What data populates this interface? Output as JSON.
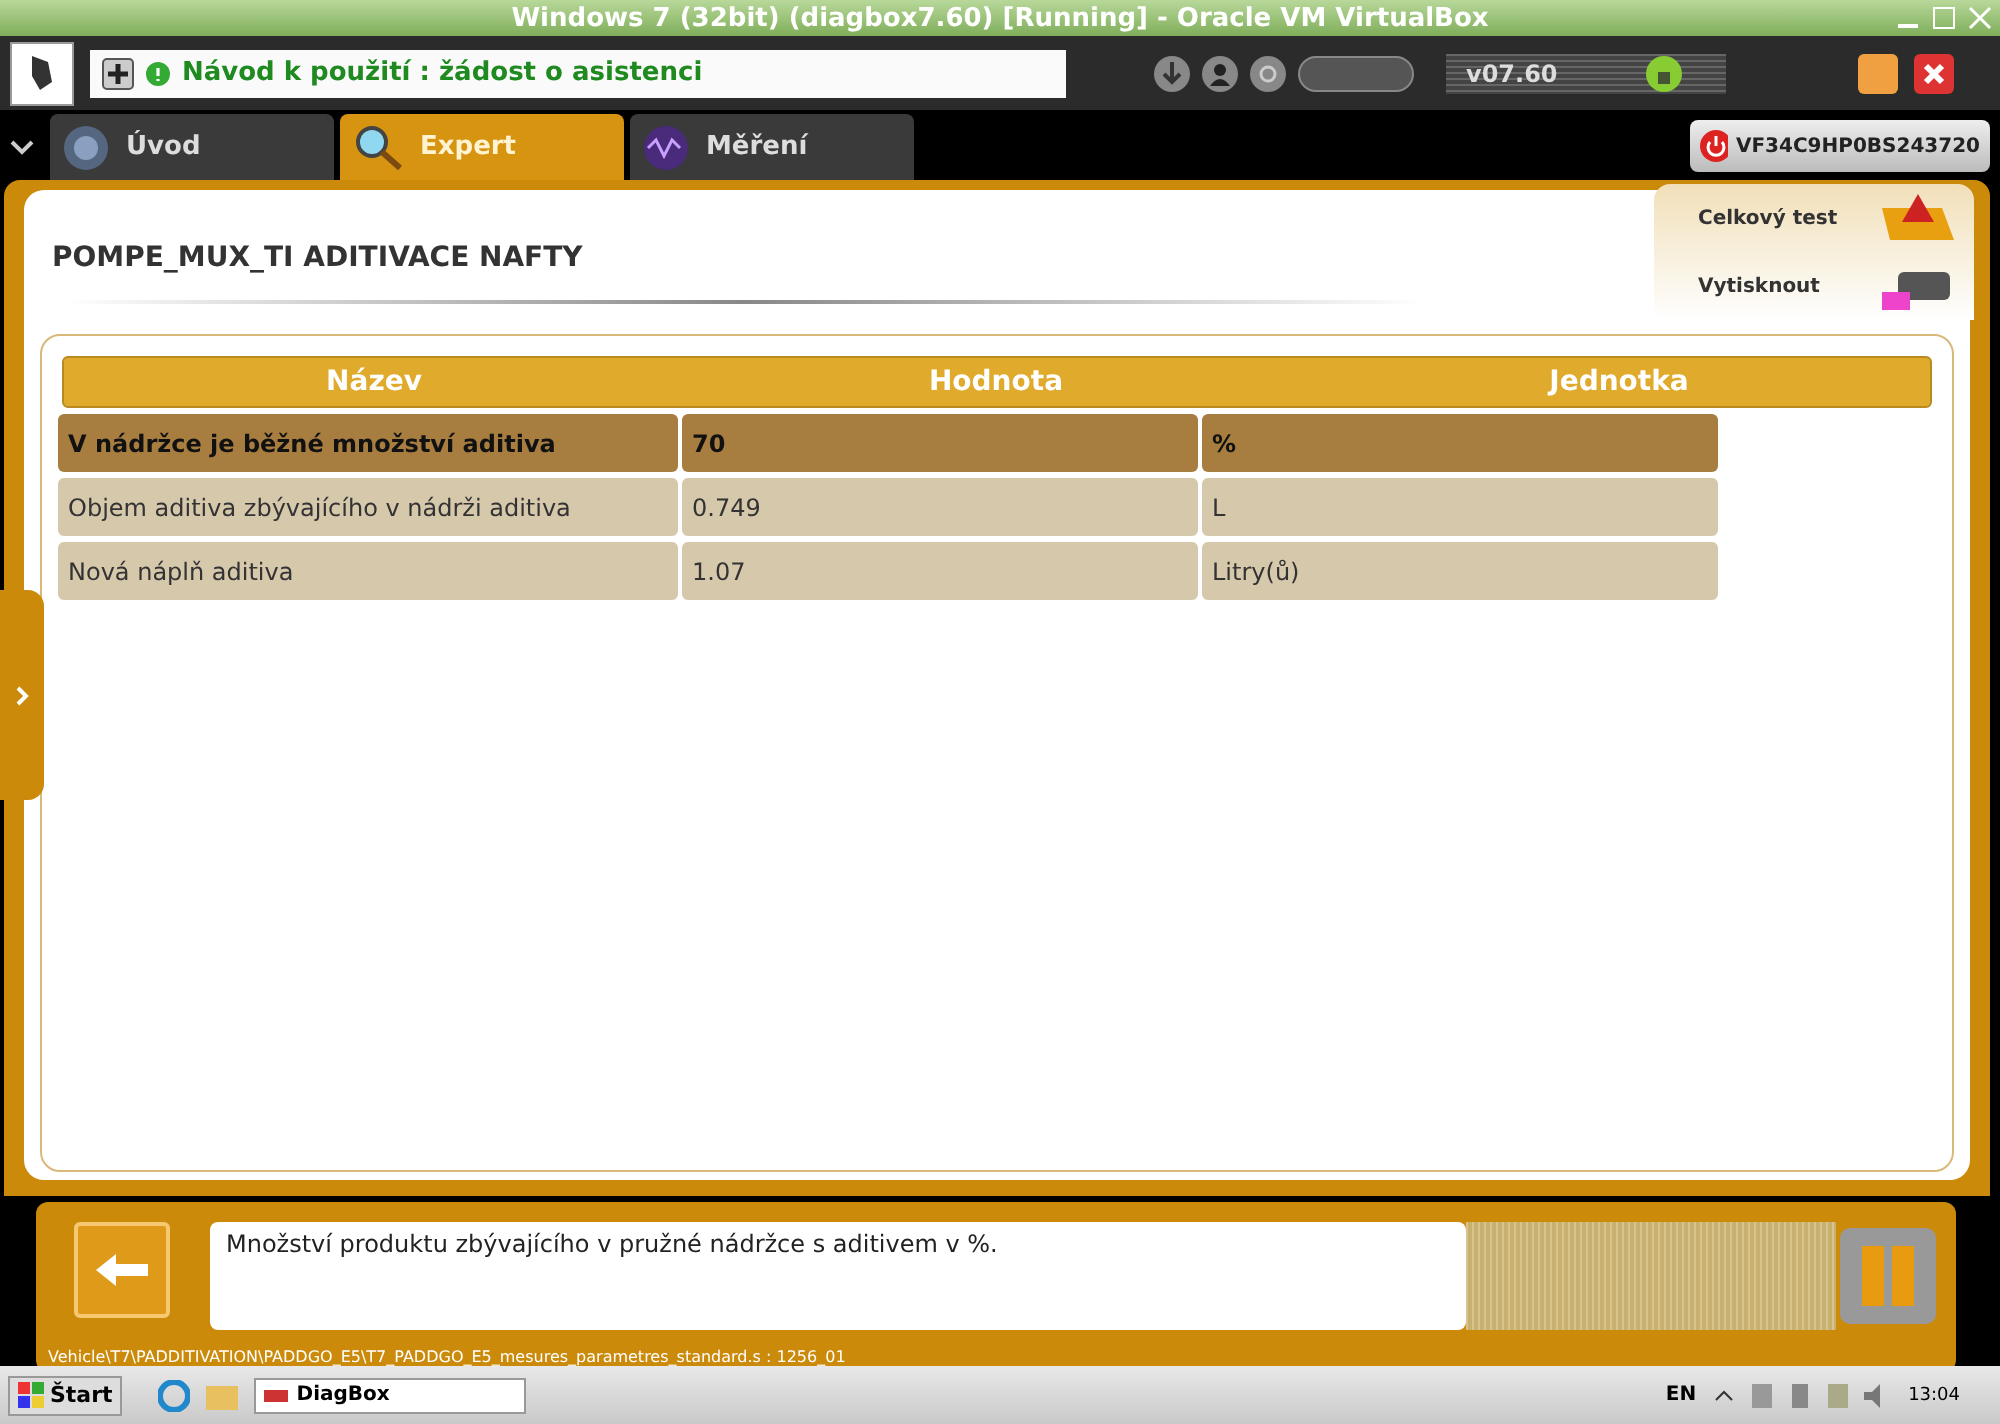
{
  "window": {
    "title": "Windows 7 (32bit) (diagbox7.60) [Running] - Oracle VM VirtualBox"
  },
  "header": {
    "info": "Návod k použití : žádost o asistenci",
    "version": "v07.60"
  },
  "tabs": [
    {
      "label": "Úvod",
      "selected": false
    },
    {
      "label": "Expert",
      "selected": true
    },
    {
      "label": "Měření",
      "selected": false
    }
  ],
  "vin": "VF34C9HP0BS243720",
  "page_title": "POMPE_MUX_TI  ADITIVACE NAFTY",
  "actions": [
    "Celkový test",
    "Vytisknout"
  ],
  "table": {
    "columns": [
      "Název",
      "Hodnota",
      "Jednotka"
    ],
    "rows": [
      {
        "cells": [
          "V nádržce je běžné množství aditiva",
          "70",
          "%"
        ],
        "selected": true
      },
      {
        "cells": [
          "Objem aditiva zbývajícího v nádrži aditiva",
          "0.749",
          "L"
        ],
        "selected": false
      },
      {
        "cells": [
          "Nová náplň aditiva",
          "1.07",
          "Litry(ů)"
        ],
        "selected": false
      }
    ]
  },
  "message": "Množství produktu zbývajícího v pružné nádržce s aditivem v %.",
  "path": "Vehicle\\T7\\PADDITIVATION\\PADDGO_E5\\T7_PADDGO_E5_mesures_parametres_standard.s : 1256_01",
  "taskbar": {
    "start": "Štart",
    "task": "DiagBox",
    "lang": "EN",
    "time": "13:04"
  }
}
